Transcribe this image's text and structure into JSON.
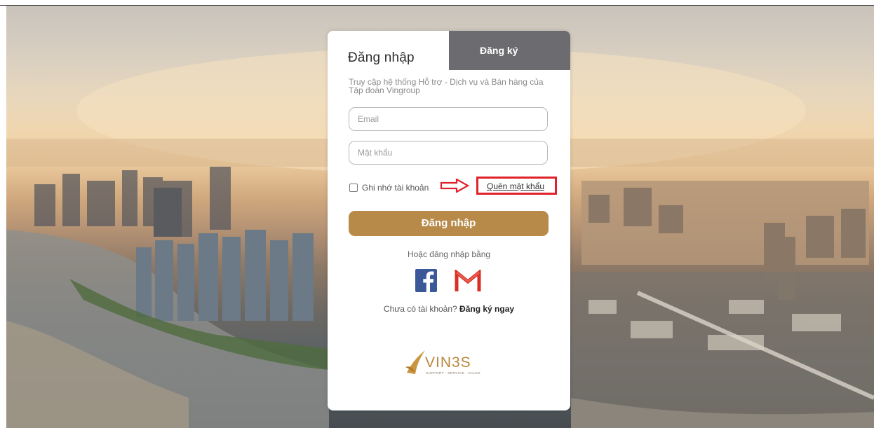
{
  "tabs": {
    "login_label": "Đăng nhập",
    "register_label": "Đăng ký"
  },
  "intro": "Truy cập hệ thống Hỗ trợ - Dịch vụ và Bán hàng của Tập đoàn Vingroup",
  "form": {
    "email_placeholder": "Email",
    "password_placeholder": "Mật khẩu",
    "remember_label": "Ghi nhớ tài khoản",
    "forgot_label": "Quên mật khẩu",
    "submit_label": "Đăng nhập"
  },
  "social": {
    "alt_text": "Hoặc đăng nhập bằng",
    "facebook_icon": "facebook-icon",
    "gmail_icon": "gmail-icon"
  },
  "signup": {
    "question": "Chưa có tài khoản?",
    "link_label": "Đăng ký ngay"
  },
  "logo": {
    "name": "VIN3S",
    "tagline": "SUPPORT · SERVICE · SALES"
  },
  "colors": {
    "accent": "#b78a4a",
    "tab_inactive": "#6c6c70",
    "highlight": "#e0222a",
    "facebook": "#3b5998",
    "gmail_red": "#d93025"
  }
}
